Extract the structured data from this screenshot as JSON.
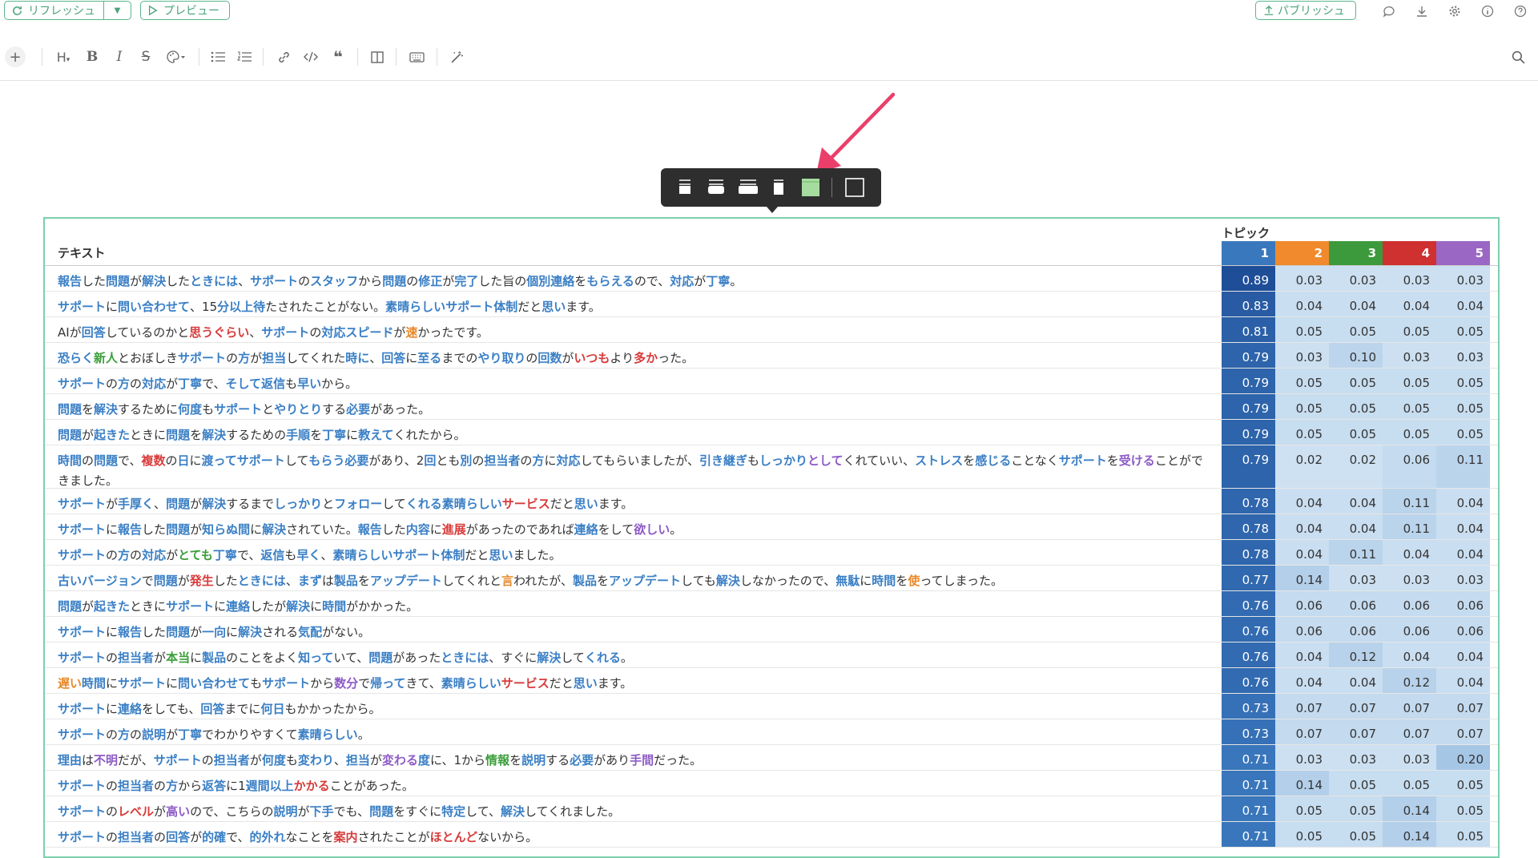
{
  "topbar": {
    "refresh_label": "リフレッシュ",
    "preview_label": "プレビュー",
    "publish_label": "パブリッシュ",
    "icons": [
      "comment-icon",
      "download-icon",
      "gear-icon",
      "info-icon",
      "help-icon"
    ]
  },
  "toolbar": {
    "items": [
      "plus",
      "heading",
      "bold",
      "italic",
      "strikethrough",
      "color",
      "bullet-list",
      "numbered-list",
      "link",
      "code",
      "quote",
      "columns",
      "keyboard",
      "magic"
    ]
  },
  "popup": {
    "options": [
      "width-1",
      "width-2",
      "width-3",
      "width-4",
      "width-5-selected",
      "border-toggle"
    ],
    "selected": "width-5-selected"
  },
  "table": {
    "text_header": "テキスト",
    "topic_header": "トピック",
    "topic_columns": [
      {
        "label": "1",
        "color": "#3a78bd"
      },
      {
        "label": "2",
        "color": "#f08a2c"
      },
      {
        "label": "3",
        "color": "#3c9a3c"
      },
      {
        "label": "4",
        "color": "#cf3030"
      },
      {
        "label": "5",
        "color": "#9b67c4"
      }
    ],
    "rows": [
      {
        "text": "<span class='b'>報告</span>した<span class='b'>問題</span>が<span class='b'>解決</span>した<span class='b'>ときには</span>、<span class='b'>サポート</span>の<span class='b'>スタッフ</span>から<span class='b'>問題</span>の<span class='b'>修正</span>が<span class='b'>完了</span>した旨の<span class='b'>個別連絡</span>を<span class='b'>もらえる</span>ので、<span class='b'>対応</span>が<span class='b'>丁寧</span>。",
        "values": [
          "0.89",
          "0.03",
          "0.03",
          "0.03",
          "0.03"
        ]
      },
      {
        "text": "<span class='b'>サポート</span>に<span class='b'>問い合わせて</span>、15<span class='b'>分以上待</span>たされたことがない。<span class='b'>素晴らしい</span><span class='b'>サポート体制</span>だと<span class='b'>思い</span>ます。",
        "values": [
          "0.83",
          "0.04",
          "0.04",
          "0.04",
          "0.04"
        ]
      },
      {
        "text": "AIが<span class='b'>回答</span>しているのかと<span class='r'>思うぐらい</span>、<span class='b'>サポート</span>の<span class='b'>対応スピード</span>が<span class='o'>速</span>かったです。",
        "values": [
          "0.81",
          "0.05",
          "0.05",
          "0.05",
          "0.05"
        ]
      },
      {
        "text": "<span class='b'>恐らく</span><span class='g'>新人</span>とおぼしき<span class='b'>サポート</span>の<span class='b'>方</span>が<span class='b'>担当</span>してくれた<span class='b'>時に</span>、<span class='b'>回答</span>に<span class='b'>至る</span>までの<span class='b'>やり取り</span>の<span class='b'>回数</span>が<span class='r'>いつも</span>より<span class='r'>多か</span>った。",
        "values": [
          "0.79",
          "0.03",
          "0.10",
          "0.03",
          "0.03"
        ]
      },
      {
        "text": "<span class='b'>サポート</span>の<span class='b'>方</span>の<span class='b'>対応</span>が<span class='b'>丁寧</span>で、<span class='b'>そして返信</span>も<span class='b'>早い</span>から。",
        "values": [
          "0.79",
          "0.05",
          "0.05",
          "0.05",
          "0.05"
        ]
      },
      {
        "text": "<span class='b'>問題</span>を<span class='b'>解決</span>するために<span class='b'>何度</span>も<span class='b'>サポート</span>と<span class='b'>やりとり</span>する<span class='b'>必要</span>があった。",
        "values": [
          "0.79",
          "0.05",
          "0.05",
          "0.05",
          "0.05"
        ]
      },
      {
        "text": "<span class='b'>問題</span>が<span class='b'>起きた</span>ときに<span class='b'>問題</span>を<span class='b'>解決</span>するための<span class='b'>手順</span>を<span class='b'>丁寧</span>に<span class='b'>教えて</span>くれたから。",
        "values": [
          "0.79",
          "0.05",
          "0.05",
          "0.05",
          "0.05"
        ]
      },
      {
        "text": "<span class='b'>時間</span>の<span class='b'>問題</span>で、<span class='r'>複数</span>の<span class='b'>日</span>に<span class='b'>渡って</span><span class='b'>サポート</span>して<span class='b'>もらう必要</span>があり、2<span class='b'>回</span>とも<span class='b'>別</span>の<span class='b'>担当者</span>の<span class='b'>方</span>に<span class='b'>対応</span>してもらいましたが、<span class='b'>引き継ぎ</span>も<span class='b'>しっかり</span><span class='p'>として</span>くれていい、<span class='b'>ストレス</span>を<span class='b'>感じる</span>ことなく<span class='b'>サポート</span>を<span class='p'>受ける</span>ことができました。",
        "values": [
          "0.79",
          "0.02",
          "0.02",
          "0.06",
          "0.11"
        ]
      },
      {
        "text": "<span class='b'>サポート</span>が<span class='b'>手厚く</span>、<span class='b'>問題</span>が<span class='b'>解決</span>するまで<span class='b'>しっかり</span>と<span class='b'>フォロー</span>して<span class='b'>くれる素晴らしい</span><span class='r'>サービス</span>だと<span class='b'>思い</span>ます。",
        "values": [
          "0.78",
          "0.04",
          "0.04",
          "0.11",
          "0.04"
        ]
      },
      {
        "text": "<span class='b'>サポート</span>に<span class='b'>報告</span>した<span class='b'>問題</span>が<span class='b'>知らぬ間</span>に<span class='b'>解決</span>されていた。<span class='b'>報告</span>した<span class='b'>内容</span>に<span class='r'>進展</span>があったのであれば<span class='b'>連絡</span>をして<span class='p'>欲しい</span>。",
        "values": [
          "0.78",
          "0.04",
          "0.04",
          "0.11",
          "0.04"
        ]
      },
      {
        "text": "<span class='b'>サポート</span>の<span class='b'>方</span>の<span class='b'>対応</span>が<span class='g'>とても</span><span class='b'>丁寧</span>で、<span class='b'>返信</span>も<span class='b'>早く</span>、<span class='b'>素晴らしい</span><span class='b'>サポート体制</span>だと<span class='b'>思い</span>ました。",
        "values": [
          "0.78",
          "0.04",
          "0.11",
          "0.04",
          "0.04"
        ]
      },
      {
        "text": "<span class='b'>古い</span><span class='b'>バージョン</span>で<span class='b'>問題</span>が<span class='r'>発生</span>した<span class='b'>ときには</span>、<span class='b'>まず</span>は<span class='b'>製品</span>を<span class='b'>アップデート</span>してくれと<span class='o'>言</span>われたが、<span class='b'>製品</span>を<span class='b'>アップデート</span>しても<span class='b'>解決</span>しなかったので、<span class='b'>無駄</span>に<span class='b'>時間</span>を<span class='o'>使</span>ってしまった。",
        "values": [
          "0.77",
          "0.14",
          "0.03",
          "0.03",
          "0.03"
        ]
      },
      {
        "text": "<span class='b'>問題</span>が<span class='b'>起きた</span>ときに<span class='b'>サポート</span>に<span class='b'>連絡</span>したが<span class='b'>解決</span>に<span class='b'>時間</span>がかかった。",
        "values": [
          "0.76",
          "0.06",
          "0.06",
          "0.06",
          "0.06"
        ]
      },
      {
        "text": "<span class='b'>サポート</span>に<span class='b'>報告</span>した<span class='b'>問題</span>が<span class='b'>一向</span>に<span class='b'>解決</span>される<span class='b'>気配</span>がない。",
        "values": [
          "0.76",
          "0.06",
          "0.06",
          "0.06",
          "0.06"
        ]
      },
      {
        "text": "<span class='b'>サポート</span>の<span class='b'>担当者</span>が<span class='g'>本当</span>に<span class='b'>製品</span>のことをよく<span class='b'>知って</span>いて、<span class='b'>問題</span>があった<span class='b'>ときには</span>、すぐに<span class='b'>解決</span>して<span class='b'>くれる</span>。",
        "values": [
          "0.76",
          "0.04",
          "0.12",
          "0.04",
          "0.04"
        ]
      },
      {
        "text": "<span class='o'>遅い</span><span class='b'>時間</span>に<span class='b'>サポート</span>に<span class='b'>問い合わせて</span>も<span class='b'>サポート</span>から<span class='p'>数分</span>で<span class='b'>帰って</span>きて、<span class='b'>素晴らしい</span><span class='r'>サービス</span>だと<span class='b'>思い</span>ます。",
        "values": [
          "0.76",
          "0.04",
          "0.04",
          "0.12",
          "0.04"
        ]
      },
      {
        "text": "<span class='b'>サポート</span>に<span class='b'>連絡</span>をしても、<span class='b'>回答</span>までに<span class='b'>何日</span>もかかったから。",
        "values": [
          "0.73",
          "0.07",
          "0.07",
          "0.07",
          "0.07"
        ]
      },
      {
        "text": "<span class='b'>サポート</span>の<span class='b'>方</span>の<span class='b'>説明</span>が<span class='b'>丁寧</span>でわかりやすくて<span class='b'>素晴らしい</span>。",
        "values": [
          "0.73",
          "0.07",
          "0.07",
          "0.07",
          "0.07"
        ]
      },
      {
        "text": "<span class='b'>理由</span>は<span class='p'>不明</span>だが、<span class='b'>サポート</span>の<span class='b'>担当者</span>が<span class='b'>何度</span>も<span class='b'>変わり</span>、<span class='b'>担当</span>が<span class='p'>変わる</span><span class='b'>度</span>に、1から<span class='g'>情報</span>を<span class='b'>説明</span>する<span class='b'>必要</span>があり<span class='p'>手間</span>だった。",
        "values": [
          "0.71",
          "0.03",
          "0.03",
          "0.03",
          "0.20"
        ]
      },
      {
        "text": "<span class='b'>サポート</span>の<span class='b'>担当者</span>の<span class='b'>方</span>から<span class='b'>返答</span>に1<span class='b'>週間以上</span><span class='r'>かかる</span>ことがあった。",
        "values": [
          "0.71",
          "0.14",
          "0.05",
          "0.05",
          "0.05"
        ]
      },
      {
        "text": "<span class='b'>サポート</span>の<span class='r'>レベル</span>が<span class='p'>高い</span>ので、こちらの<span class='b'>説明</span>が<span class='b'>下手</span>でも、<span class='b'>問題</span>をすぐに<span class='b'>特定</span>して、<span class='b'>解決</span>してくれました。",
        "values": [
          "0.71",
          "0.05",
          "0.05",
          "0.14",
          "0.05"
        ]
      },
      {
        "text": "<span class='b'>サポート</span>の<span class='b'>担当者</span>の<span class='b'>回答</span>が<span class='b'>的確</span>で、<span class='b'>的外れ</span>なことを<span class='r'>案内</span>されたことが<span class='r'>ほとんど</span>ないから。",
        "values": [
          "0.71",
          "0.05",
          "0.05",
          "0.14",
          "0.05"
        ]
      }
    ]
  }
}
